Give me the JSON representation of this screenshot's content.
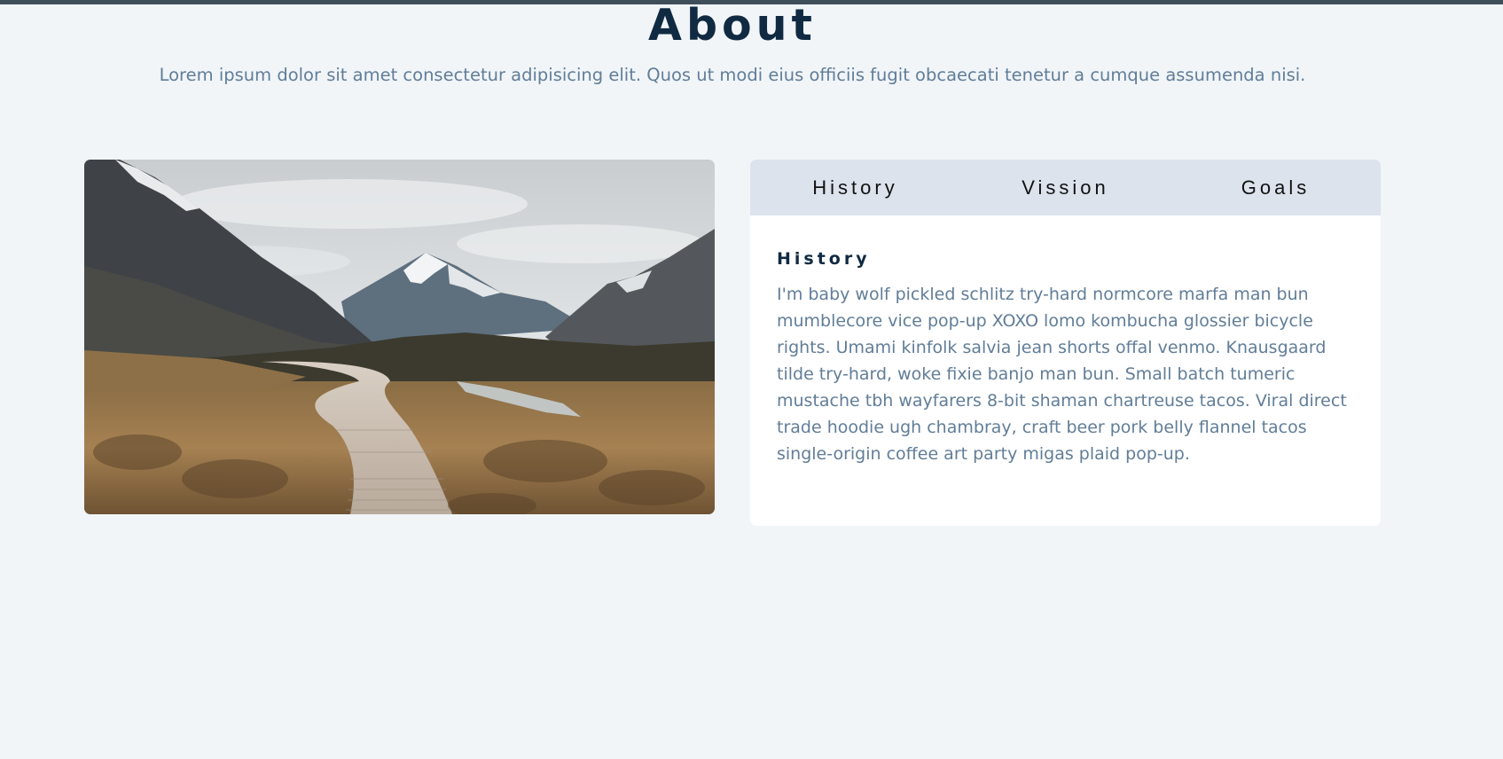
{
  "header": {
    "title": "About",
    "subtitle": "Lorem ipsum dolor sit amet consectetur adipisicing elit. Quos ut modi eius officiis fugit obcaecati tenetur a cumque assumenda nisi."
  },
  "tabs": [
    {
      "label": "History",
      "active": true
    },
    {
      "label": "Vission",
      "active": false
    },
    {
      "label": "Goals",
      "active": false
    }
  ],
  "content": {
    "heading": "History",
    "text": "I'm baby wolf pickled schlitz try-hard normcore marfa man bun mumblecore vice pop-up XOXO lomo kombucha glossier bicycle rights. Umami kinfolk salvia jean shorts offal venmo. Knausgaard tilde try-hard, woke fixie banjo man bun. Small batch tumeric mustache tbh wayfarers 8-bit shaman chartreuse tacos. Viral direct trade hoodie ugh chambray, craft beer pork belly flannel tacos single-origin coffee art party migas plaid pop-up."
  },
  "colors": {
    "background": "#f1f5f8",
    "title": "#102a42",
    "text": "#617d98",
    "tab_bar": "#dce3ec",
    "top_bar": "#3f4f5a"
  },
  "image": {
    "icon": "mountain-valley-boardwalk-photo"
  }
}
